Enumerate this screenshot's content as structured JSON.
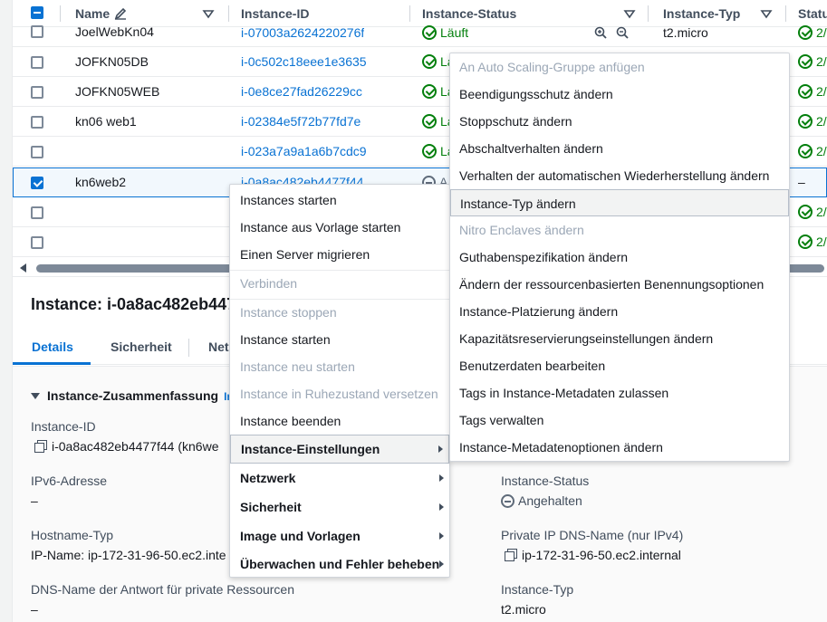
{
  "table": {
    "headers": {
      "name": "Name",
      "instance_id": "Instance-ID",
      "instance_status": "Instance-Status",
      "instance_type": "Instance-Typ",
      "status_check": "Statu"
    },
    "rows": [
      {
        "name": "JoelWebKn04",
        "id": "i-07003a2624220276f",
        "status": "Läuft",
        "type": "t2.micro",
        "check": "2/"
      },
      {
        "name": "JOFKN05DB",
        "id": "i-0c502c18eee1e3635",
        "status": "La",
        "type": "",
        "check": "2/"
      },
      {
        "name": "JOFKN05WEB",
        "id": "i-0e8ce27fad26229cc",
        "status": "La",
        "type": "",
        "check": "2/"
      },
      {
        "name": "kn06 web1",
        "id": "i-02384e5f72b77fd7e",
        "status": "La",
        "type": "",
        "check": "2/"
      },
      {
        "name": "",
        "id": "i-023a7a9a1a6b7cdc9",
        "status": "La",
        "type": "",
        "check": "2/"
      },
      {
        "name": "kn6web2",
        "id": "i-0a8ac482eb4477f44",
        "status": "A",
        "type": "",
        "check": "–"
      },
      {
        "name": "",
        "id": "",
        "status": "",
        "type": "",
        "check": "2/"
      },
      {
        "name": "",
        "id": "",
        "status": "",
        "type": "",
        "check": "2/"
      }
    ]
  },
  "details": {
    "title": "Instance: i-0a8ac482eb447",
    "tabs": [
      "Details",
      "Sicherheit",
      "Net"
    ],
    "summary_header": "Instance-Zusammenfassung",
    "summary_info": "In",
    "fields": {
      "instance_id_label": "Instance-ID",
      "instance_id_value": "i-0a8ac482eb4477f44 (kn6we",
      "ipv6_label": "IPv6-Adresse",
      "ipv6_value": "–",
      "hostname_label": "Hostname-Typ",
      "hostname_value": "IP-Name: ip-172-31-96-50.ec2.inte",
      "dns_label": "DNS-Name der Antwort für private Ressourcen",
      "dns_value": "–",
      "inst_status_label": "Instance-Status",
      "inst_status_value": "Angehalten",
      "private_dns_label": "Private IP DNS-Name (nur IPv4)",
      "private_dns_value": "ip-172-31-96-50.ec2.internal",
      "inst_type_label": "Instance-Typ",
      "inst_type_value": "t2.micro"
    }
  },
  "context_menu": {
    "items": [
      {
        "label": "Instances starten",
        "state": "normal"
      },
      {
        "label": "Instance aus Vorlage starten",
        "state": "normal"
      },
      {
        "label": "Einen Server migrieren",
        "state": "normal"
      },
      {
        "label": "Verbinden",
        "state": "disabled"
      },
      {
        "label": "Instance stoppen",
        "state": "disabled"
      },
      {
        "label": "Instance starten",
        "state": "normal"
      },
      {
        "label": "Instance neu starten",
        "state": "disabled"
      },
      {
        "label": "Instance in Ruhezustand versetzen",
        "state": "disabled"
      },
      {
        "label": "Instance beenden",
        "state": "normal"
      },
      {
        "label": "Instance-Einstellungen",
        "state": "bold-active"
      },
      {
        "label": "Netzwerk",
        "state": "bold"
      },
      {
        "label": "Sicherheit",
        "state": "bold"
      },
      {
        "label": "Image und Vorlagen",
        "state": "bold"
      },
      {
        "label": "Überwachen und Fehler beheben",
        "state": "bold"
      }
    ]
  },
  "submenu": {
    "items": [
      {
        "label": "An Auto Scaling-Gruppe anfügen",
        "state": "disabled"
      },
      {
        "label": "Beendigungsschutz ändern",
        "state": "normal"
      },
      {
        "label": "Stoppschutz ändern",
        "state": "normal"
      },
      {
        "label": "Abschaltverhalten ändern",
        "state": "normal"
      },
      {
        "label": "Verhalten der automatischen Wiederherstellung ändern",
        "state": "normal"
      },
      {
        "label": "Instance-Typ ändern",
        "state": "highlight"
      },
      {
        "label": "Nitro Enclaves ändern",
        "state": "disabled"
      },
      {
        "label": "Guthabenspezifikation ändern",
        "state": "normal"
      },
      {
        "label": "Ändern der ressourcenbasierten Benennungsoptionen",
        "state": "normal"
      },
      {
        "label": "Instance-Platzierung ändern",
        "state": "normal"
      },
      {
        "label": "Kapazitätsreservierungseinstellungen ändern",
        "state": "normal"
      },
      {
        "label": "Benutzerdaten bearbeiten",
        "state": "normal"
      },
      {
        "label": "Tags in Instance-Metadaten zulassen",
        "state": "normal"
      },
      {
        "label": "Tags verwalten",
        "state": "normal"
      },
      {
        "label": "Instance-Metadatenoptionen ändern",
        "state": "normal"
      }
    ]
  }
}
